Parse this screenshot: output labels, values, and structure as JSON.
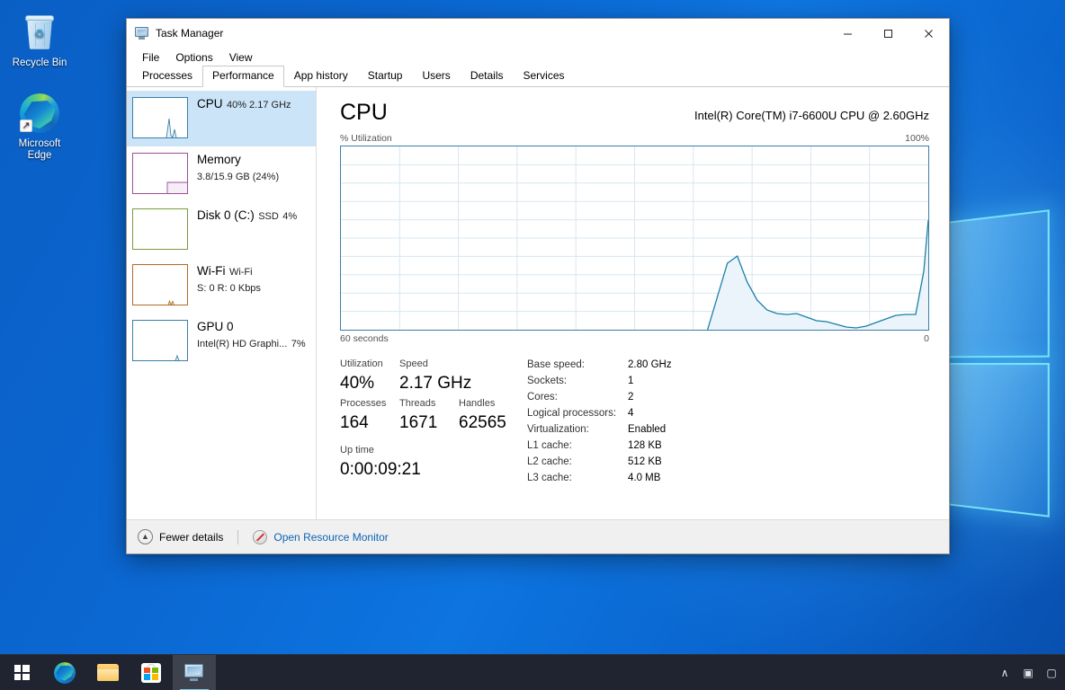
{
  "desktop": {
    "icons": [
      {
        "name": "recycle-bin",
        "label": "Recycle Bin"
      },
      {
        "name": "microsoft-edge",
        "label": "Microsoft Edge"
      }
    ]
  },
  "window": {
    "title": "Task Manager",
    "controls": {
      "minimize": "─",
      "maximize": "□",
      "close": "✕"
    },
    "menu": [
      "File",
      "Options",
      "View"
    ],
    "tabs": [
      {
        "label": "Processes",
        "active": false
      },
      {
        "label": "Performance",
        "active": true
      },
      {
        "label": "App history",
        "active": false
      },
      {
        "label": "Startup",
        "active": false
      },
      {
        "label": "Users",
        "active": false
      },
      {
        "label": "Details",
        "active": false
      },
      {
        "label": "Services",
        "active": false
      }
    ]
  },
  "sidebar": {
    "items": [
      {
        "title": "CPU",
        "sub1": "40%  2.17 GHz",
        "sub2": "",
        "sub3": "",
        "color": "#3a7fa8",
        "selected": true
      },
      {
        "title": "Memory",
        "sub1": "3.8/15.9 GB (24%)",
        "sub2": "",
        "sub3": "",
        "color": "#9b4f96",
        "selected": false
      },
      {
        "title": "Disk 0 (C:)",
        "sub1": "SSD",
        "sub2": "4%",
        "sub3": "",
        "color": "#7a9a3a",
        "selected": false
      },
      {
        "title": "Wi-Fi",
        "sub1": "Wi-Fi",
        "sub2": "S: 0  R: 0 Kbps",
        "sub3": "",
        "color": "#b06a28",
        "selected": false
      },
      {
        "title": "GPU 0",
        "sub1": "Intel(R) HD Graphi...",
        "sub2": "7%",
        "sub3": "",
        "color": "#3a7fa8",
        "selected": false
      }
    ]
  },
  "main": {
    "heading": "CPU",
    "model": "Intel(R) Core(TM) i7-6600U CPU @ 2.60GHz",
    "graph_label_left": "% Utilization",
    "graph_label_right": "100%",
    "graph_foot_left": "60 seconds",
    "graph_foot_right": "0",
    "stats": {
      "utilization_label": "Utilization",
      "utilization_value": "40%",
      "speed_label": "Speed",
      "speed_value": "2.17 GHz",
      "processes_label": "Processes",
      "processes_value": "164",
      "threads_label": "Threads",
      "threads_value": "1671",
      "handles_label": "Handles",
      "handles_value": "62565",
      "uptime_label": "Up time",
      "uptime_value": "0:00:09:21"
    },
    "specs": [
      {
        "key": "Base speed:",
        "value": "2.80 GHz"
      },
      {
        "key": "Sockets:",
        "value": "1"
      },
      {
        "key": "Cores:",
        "value": "2"
      },
      {
        "key": "Logical processors:",
        "value": "4"
      },
      {
        "key": "Virtualization:",
        "value": "Enabled"
      },
      {
        "key": "L1 cache:",
        "value": "128 KB"
      },
      {
        "key": "L2 cache:",
        "value": "512 KB"
      },
      {
        "key": "L3 cache:",
        "value": "4.0 MB"
      }
    ]
  },
  "footer": {
    "fewer_details": "Fewer details",
    "open_resource_monitor": "Open Resource Monitor",
    "link_color": "#0a64b4"
  },
  "taskbar": {
    "apps": [
      {
        "name": "start-button",
        "label": "Start"
      },
      {
        "name": "taskbar-edge",
        "label": "Microsoft Edge"
      },
      {
        "name": "taskbar-file-explorer",
        "label": "File Explorer"
      },
      {
        "name": "taskbar-store",
        "label": "Microsoft Store"
      },
      {
        "name": "taskbar-task-manager",
        "label": "Task Manager"
      }
    ],
    "tray": [
      {
        "name": "show-hidden-icons-icon",
        "glyph": "∧"
      },
      {
        "name": "tray-app-icon",
        "glyph": "▣"
      },
      {
        "name": "tray-camera-icon",
        "glyph": "▢"
      }
    ]
  },
  "chart_data": {
    "type": "area",
    "title": "% Utilization",
    "xlabel": "60 seconds",
    "ylabel": "% Utilization",
    "xlim": [
      0,
      60
    ],
    "ylim": [
      0,
      100
    ],
    "grid": true,
    "axis_right_label": "100%",
    "axis_foot_right": "0",
    "series": [
      {
        "name": "CPU Utilization",
        "color": "#1a7fa8",
        "fill": "#eaf4fa",
        "x": [
          37.5,
          38.5,
          39.5,
          40.5,
          41.5,
          42.5,
          43.5,
          44.5,
          45.5,
          46.5,
          47.5,
          48.5,
          49.5,
          50.5,
          51.5,
          52.5,
          53.5,
          54.5,
          55.5,
          56.5,
          57.5,
          58.5,
          59.5,
          60
        ],
        "values": [
          0,
          18,
          36,
          40,
          26,
          16,
          11,
          9,
          8.5,
          9,
          7,
          5,
          4.5,
          3,
          1.5,
          1,
          2,
          4,
          6,
          8,
          8.5,
          8.5,
          32,
          60
        ]
      }
    ]
  }
}
